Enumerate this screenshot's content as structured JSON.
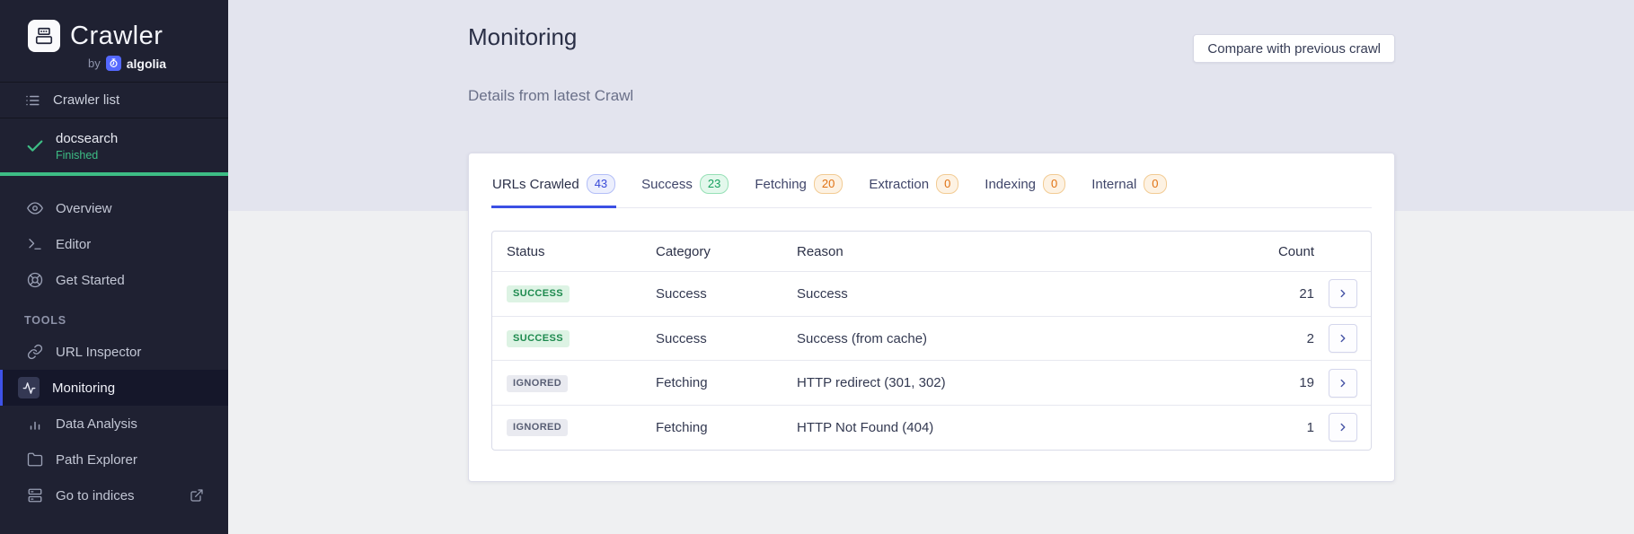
{
  "colors": {
    "accent_blue": "#3b4fe4",
    "success_green": "#3dbd85",
    "sidebar_bg": "#1f2132",
    "header_band_bg": "#e3e4ee",
    "body_bg": "#eff0f2",
    "algolia_blue": "#5468ff"
  },
  "sidebar": {
    "brand": {
      "name": "Crawler",
      "by": "by",
      "company": "algolia"
    },
    "crawler_list_label": "Crawler list",
    "current_crawler": {
      "name": "docsearch",
      "status": "Finished"
    },
    "menu": [
      {
        "label": "Overview"
      },
      {
        "label": "Editor"
      },
      {
        "label": "Get Started"
      }
    ],
    "tools_heading": "TOOLS",
    "tools": [
      {
        "label": "URL Inspector"
      },
      {
        "label": "Monitoring"
      },
      {
        "label": "Data Analysis"
      },
      {
        "label": "Path Explorer"
      },
      {
        "label": "Go to indices"
      }
    ]
  },
  "header": {
    "title": "Monitoring",
    "subtitle": "Details from latest Crawl",
    "compare_button_label": "Compare with previous crawl"
  },
  "tabs": [
    {
      "label": "URLs Crawled",
      "count": "43",
      "color": "indigo",
      "state": "active"
    },
    {
      "label": "Success",
      "count": "23",
      "color": "green",
      "state": "normal"
    },
    {
      "label": "Fetching",
      "count": "20",
      "color": "orange",
      "state": "normal"
    },
    {
      "label": "Extraction",
      "count": "0",
      "color": "orange",
      "state": "normal"
    },
    {
      "label": "Indexing",
      "count": "0",
      "color": "orange",
      "state": "normal"
    },
    {
      "label": "Internal",
      "count": "0",
      "color": "orange",
      "state": "normal"
    }
  ],
  "table": {
    "columns": [
      "Status",
      "Category",
      "Reason",
      "Count"
    ],
    "rows": [
      {
        "status": "SUCCESS",
        "status_type": "success",
        "category": "Success",
        "reason": "Success",
        "count": "21"
      },
      {
        "status": "SUCCESS",
        "status_type": "success",
        "category": "Success",
        "reason": "Success (from cache)",
        "count": "2"
      },
      {
        "status": "IGNORED",
        "status_type": "ignored",
        "category": "Fetching",
        "reason": "HTTP redirect (301, 302)",
        "count": "19"
      },
      {
        "status": "IGNORED",
        "status_type": "ignored",
        "category": "Fetching",
        "reason": "HTTP Not Found (404)",
        "count": "1"
      }
    ]
  }
}
